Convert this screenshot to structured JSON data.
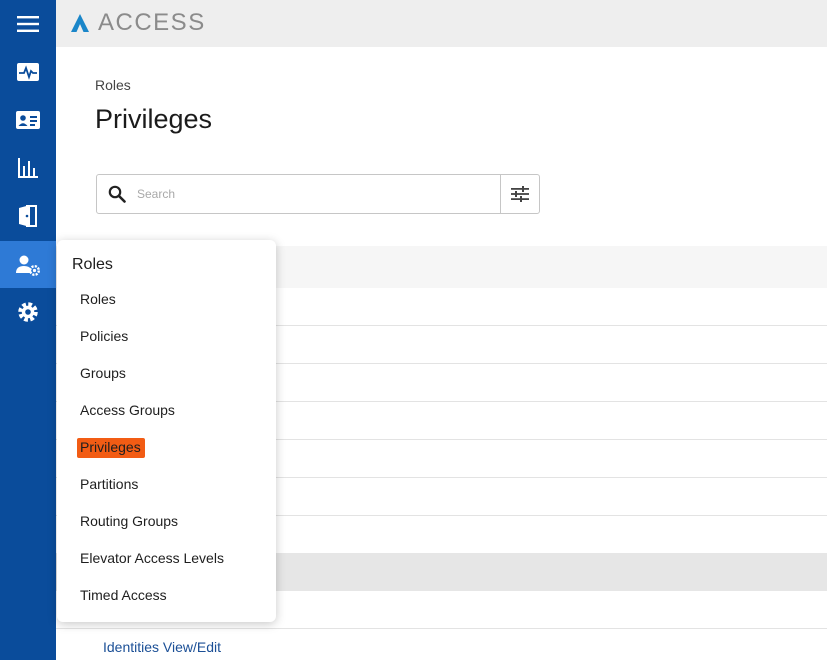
{
  "app": {
    "brand": "ACCESS",
    "colors": {
      "rail": "#0a4c9b",
      "rail_active": "#2e7ad6",
      "highlight": "#f25c14",
      "link": "#1b4f96"
    }
  },
  "rail": {
    "items": [
      {
        "name": "menu-icon"
      },
      {
        "name": "activity-monitor-icon"
      },
      {
        "name": "id-card-icon"
      },
      {
        "name": "bar-chart-icon"
      },
      {
        "name": "door-icon"
      },
      {
        "name": "user-gear-icon",
        "active": true
      },
      {
        "name": "gear-icon"
      }
    ]
  },
  "page": {
    "breadcrumb": "Roles",
    "title": "Privileges"
  },
  "search": {
    "placeholder": "Search",
    "value": ""
  },
  "flyout": {
    "title": "Roles",
    "items": [
      {
        "label": "Roles"
      },
      {
        "label": "Policies"
      },
      {
        "label": "Groups"
      },
      {
        "label": "Access Groups"
      },
      {
        "label": "Privileges",
        "highlighted": true
      },
      {
        "label": "Partitions"
      },
      {
        "label": "Routing Groups"
      },
      {
        "label": "Elevator Access Levels"
      },
      {
        "label": "Timed Access"
      }
    ]
  },
  "table": {
    "visible_row_label": "Identities View/Edit"
  }
}
